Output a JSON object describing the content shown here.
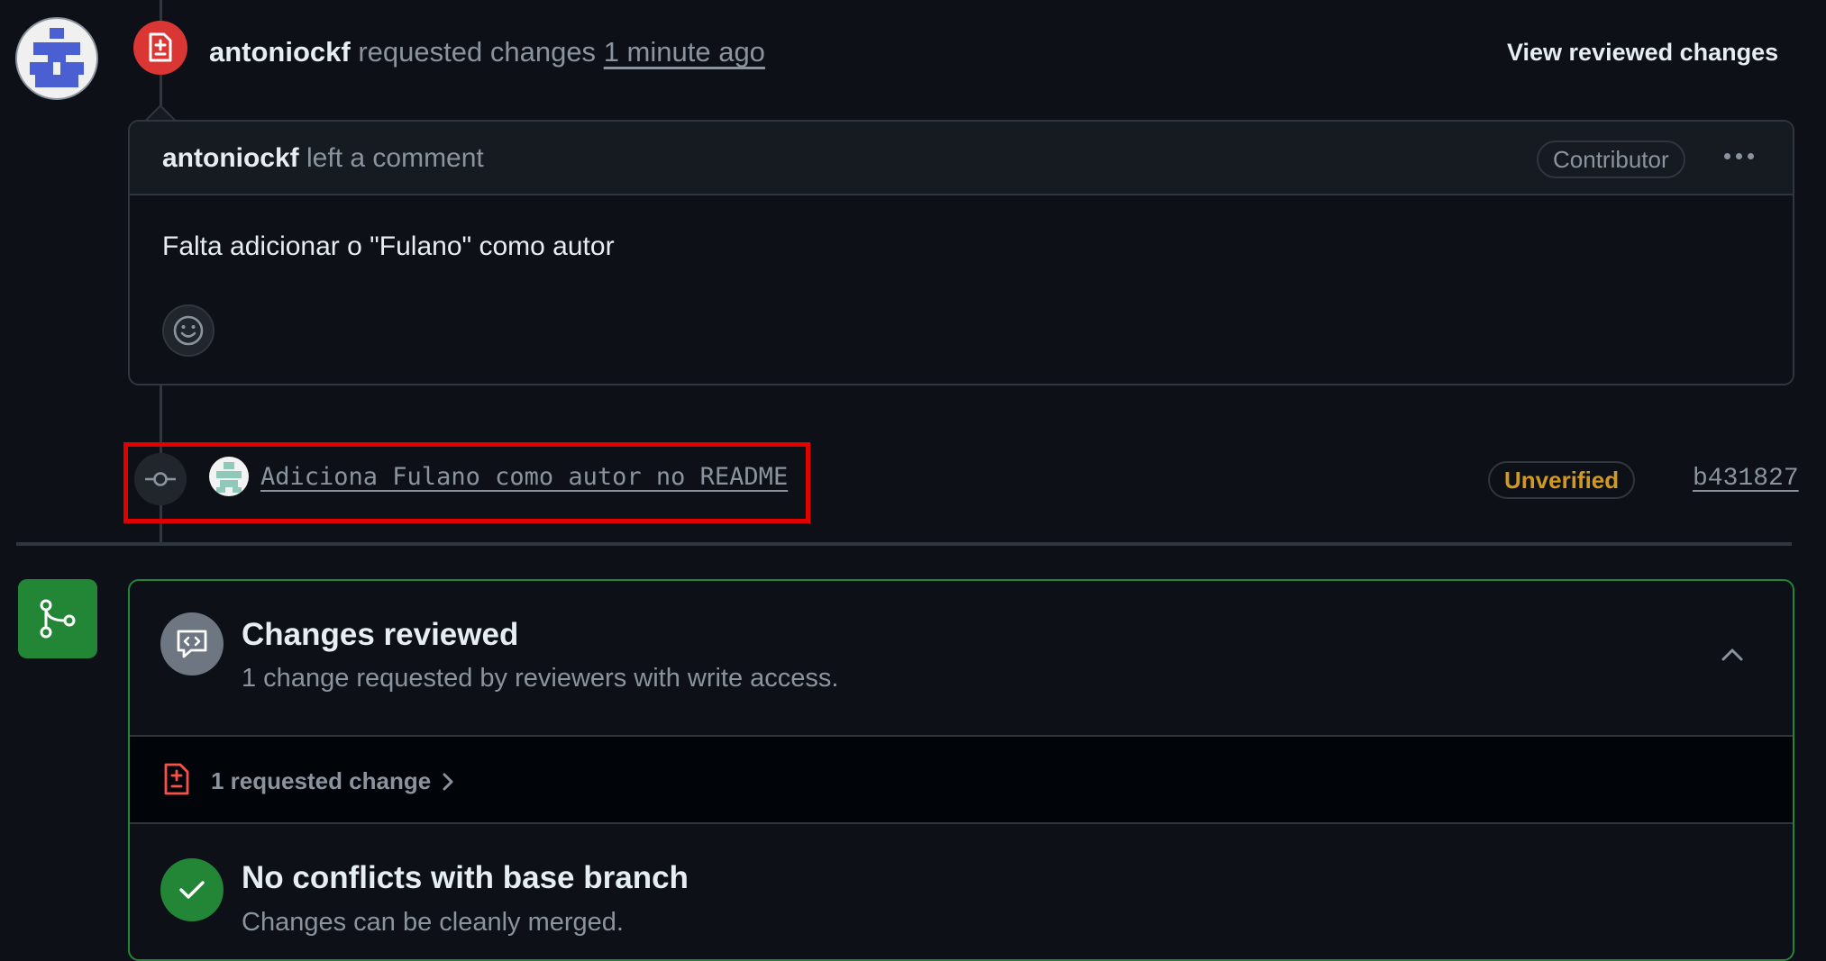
{
  "review": {
    "author": "antoniockf",
    "action": "requested changes",
    "time": "1 minute ago",
    "view_label": "View reviewed changes"
  },
  "comment": {
    "author": "antoniockf",
    "action": "left a comment",
    "badge": "Contributor",
    "body": "Falta adicionar o \"Fulano\" como autor"
  },
  "commit": {
    "message": "Adiciona Fulano como autor no README",
    "verification": "Unverified",
    "sha": "b431827"
  },
  "merge": {
    "reviewed_title": "Changes reviewed",
    "reviewed_subtitle": "1 change requested by reviewers with write access.",
    "requested_label": "1 requested change",
    "conflicts_title": "No conflicts with base branch",
    "conflicts_subtitle": "Changes can be cleanly merged."
  },
  "colors": {
    "danger": "#da3633",
    "success": "#238636",
    "attention": "#d29922",
    "highlight": "#e00000"
  },
  "icons": {
    "review_badge": "file-diff-icon",
    "commit": "git-commit-icon",
    "merge": "git-merge-icon",
    "reviewed": "code-review-icon",
    "collapse": "chevron-up-icon",
    "requested": "file-diff-icon",
    "check": "check-icon",
    "emoji": "smiley-icon"
  }
}
